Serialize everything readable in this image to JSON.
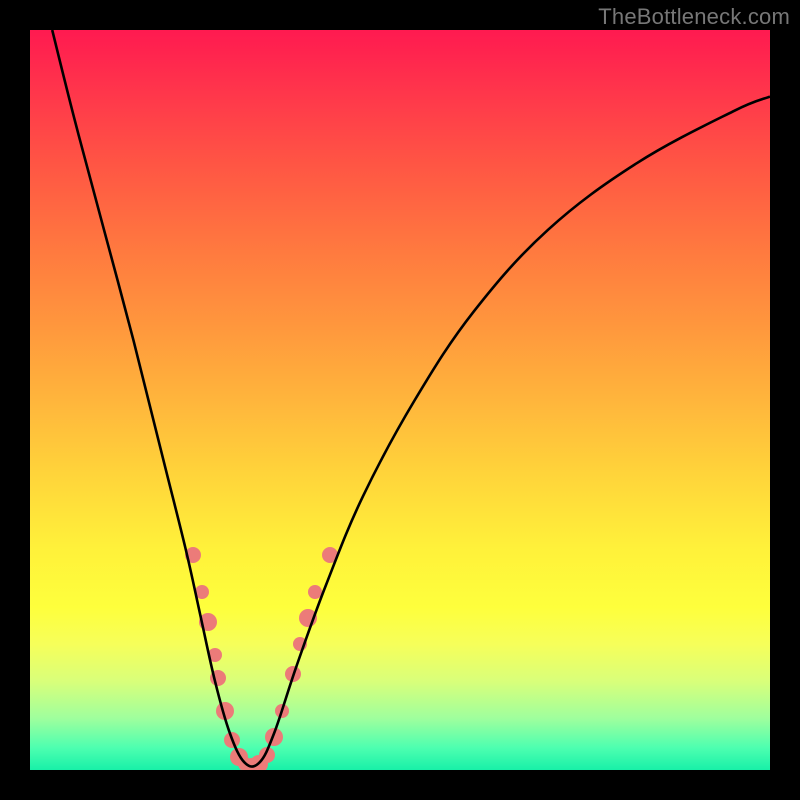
{
  "watermark": "TheBottleneck.com",
  "colors": {
    "dot": "#ec7b79",
    "curve": "#000000",
    "frame": "#000000"
  },
  "chart_data": {
    "type": "line",
    "title": "",
    "xlabel": "",
    "ylabel": "",
    "xlim": [
      0,
      100
    ],
    "ylim": [
      0,
      100
    ],
    "grid": false,
    "legend": false,
    "annotations": [
      "TheBottleneck.com"
    ],
    "series": [
      {
        "name": "bottleneck-curve",
        "x": [
          3,
          6,
          10,
          14,
          18,
          21,
          23,
          25,
          27,
          29,
          31,
          33,
          36,
          40,
          45,
          52,
          60,
          70,
          82,
          95,
          100
        ],
        "y": [
          100,
          88,
          73,
          58,
          42,
          30,
          21,
          12,
          5,
          1,
          1,
          5,
          14,
          25,
          37,
          50,
          62,
          73,
          82,
          89,
          91
        ]
      }
    ],
    "scatter_points": [
      {
        "x": 22.0,
        "y": 29.0,
        "r": 8
      },
      {
        "x": 23.2,
        "y": 24.0,
        "r": 7
      },
      {
        "x": 24.0,
        "y": 20.0,
        "r": 9
      },
      {
        "x": 25.0,
        "y": 15.5,
        "r": 7
      },
      {
        "x": 25.4,
        "y": 12.5,
        "r": 8
      },
      {
        "x": 26.3,
        "y": 8.0,
        "r": 9
      },
      {
        "x": 27.3,
        "y": 4.0,
        "r": 8
      },
      {
        "x": 28.2,
        "y": 1.8,
        "r": 9
      },
      {
        "x": 29.0,
        "y": 0.8,
        "r": 7
      },
      {
        "x": 30.0,
        "y": 0.6,
        "r": 8
      },
      {
        "x": 31.0,
        "y": 0.8,
        "r": 9
      },
      {
        "x": 32.0,
        "y": 2.0,
        "r": 8
      },
      {
        "x": 33.0,
        "y": 4.5,
        "r": 9
      },
      {
        "x": 34.0,
        "y": 8.0,
        "r": 7
      },
      {
        "x": 35.5,
        "y": 13.0,
        "r": 8
      },
      {
        "x": 36.5,
        "y": 17.0,
        "r": 7
      },
      {
        "x": 37.5,
        "y": 20.5,
        "r": 9
      },
      {
        "x": 38.5,
        "y": 24.0,
        "r": 7
      },
      {
        "x": 40.5,
        "y": 29.0,
        "r": 8
      }
    ]
  }
}
